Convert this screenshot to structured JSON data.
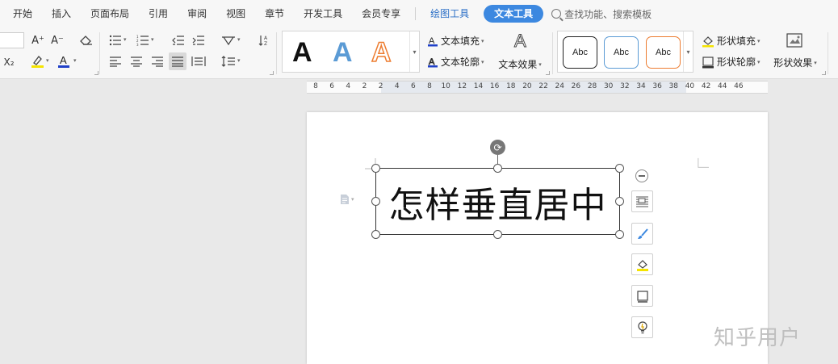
{
  "menu": {
    "tabs": [
      "开始",
      "插入",
      "页面布局",
      "引用",
      "审阅",
      "视图",
      "章节",
      "开发工具",
      "会员专享"
    ],
    "drawing_tools": "绘图工具",
    "text_tools": "文本工具",
    "search_placeholder": "查找功能、搜索模板"
  },
  "ribbon": {
    "superscript_label": "A⁺",
    "subscript_label": "A⁻",
    "x2_label": "X₂",
    "text_style_gallery": [
      "A",
      "A",
      "A"
    ],
    "text_fill": "文本填充",
    "text_outline": "文本轮廓",
    "text_effects": "文本效果",
    "shape_style_gallery": [
      "Abc",
      "Abc",
      "Abc"
    ],
    "shape_fill": "形状填充",
    "shape_outline": "形状轮廓",
    "shape_effects": "形状效果"
  },
  "ruler": {
    "ticks": [
      "8",
      "6",
      "4",
      "2",
      "2",
      "4",
      "6",
      "8",
      "10",
      "12",
      "14",
      "16",
      "18",
      "20",
      "22",
      "24",
      "26",
      "28",
      "30",
      "32",
      "34",
      "36",
      "38",
      "40",
      "42",
      "44",
      "46"
    ]
  },
  "document": {
    "textbox_text": "怎样垂直居中"
  },
  "watermark": "知乎用户",
  "colors": {
    "accent": "#3c88e0",
    "highlight_bar": "#f5e400",
    "font_color_bar": "#2040c8",
    "style_blue": "#5b9bd5",
    "style_orange": "#ed7d31"
  }
}
